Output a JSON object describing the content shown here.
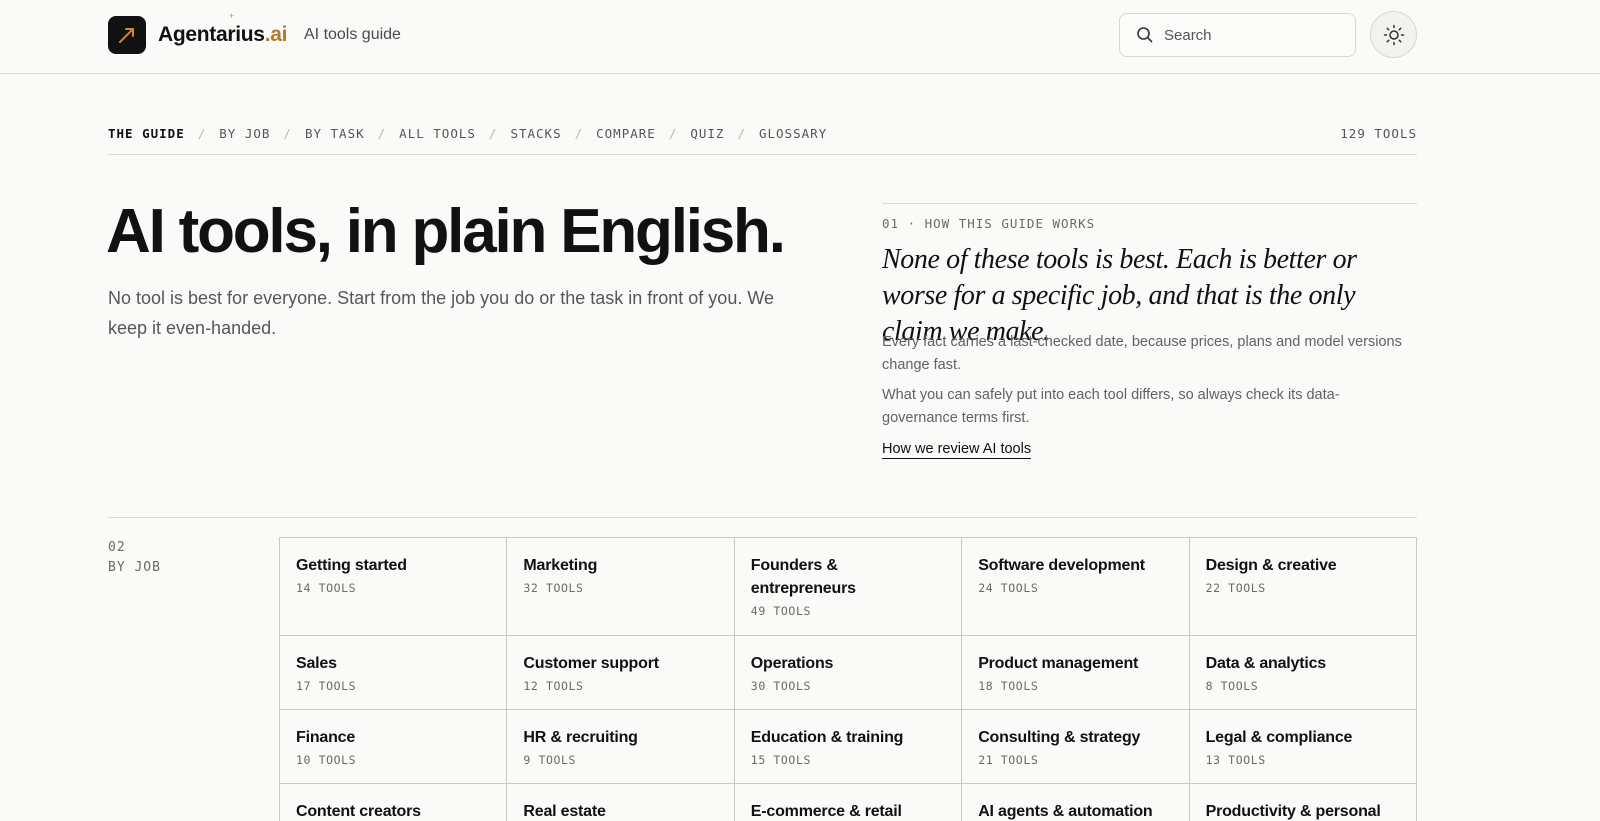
{
  "header": {
    "brand_name": "Agentarius",
    "brand_tld": ".ai",
    "brand_spark": "+",
    "subtitle": "AI tools guide",
    "search_placeholder": "Search",
    "logo_icon": "arrow-up-right-icon",
    "theme_icon": "sun-icon",
    "accent_color": "#b8782a"
  },
  "nav": {
    "items": [
      {
        "label": "THE GUIDE",
        "active": true
      },
      {
        "label": "BY JOB"
      },
      {
        "label": "BY TASK"
      },
      {
        "label": "ALL TOOLS"
      },
      {
        "label": "STACKS"
      },
      {
        "label": "COMPARE"
      },
      {
        "label": "QUIZ"
      },
      {
        "label": "GLOSSARY"
      }
    ],
    "separator": "/",
    "tool_count": "129 TOOLS"
  },
  "hero": {
    "title": "AI tools, in plain English.",
    "subtitle": "No tool is best for everyone. Start from the job you do or the task in front of you. We keep it even-handed."
  },
  "how": {
    "kicker": "01 · HOW THIS GUIDE WORKS",
    "quote": "None of these tools is best. Each is better or worse for a specific job, and that is the only claim we make.",
    "p1": "Every fact carries a last-checked date, because prices, plans and model versions change fast.",
    "p2": "What you can safely put into each tool differs, so always check its data-governance terms first.",
    "link": "How we review AI tools"
  },
  "by_job": {
    "number": "02",
    "label": "BY JOB",
    "jobs": [
      {
        "title": "Getting started",
        "count": "14 TOOLS"
      },
      {
        "title": "Marketing",
        "count": "32 TOOLS"
      },
      {
        "title": "Founders & entrepreneurs",
        "count": "49 TOOLS"
      },
      {
        "title": "Software development",
        "count": "24 TOOLS"
      },
      {
        "title": "Design & creative",
        "count": "22 TOOLS"
      },
      {
        "title": "Sales",
        "count": "17 TOOLS"
      },
      {
        "title": "Customer support",
        "count": "12 TOOLS"
      },
      {
        "title": "Operations",
        "count": "30 TOOLS"
      },
      {
        "title": "Product management",
        "count": "18 TOOLS"
      },
      {
        "title": "Data & analytics",
        "count": "8 TOOLS"
      },
      {
        "title": "Finance",
        "count": "10 TOOLS"
      },
      {
        "title": "HR & recruiting",
        "count": "9 TOOLS"
      },
      {
        "title": "Education & training",
        "count": "15 TOOLS"
      },
      {
        "title": "Consulting & strategy",
        "count": "21 TOOLS"
      },
      {
        "title": "Legal & compliance",
        "count": "13 TOOLS"
      },
      {
        "title": "Content creators",
        "count": ""
      },
      {
        "title": "Real estate",
        "count": ""
      },
      {
        "title": "E-commerce & retail",
        "count": ""
      },
      {
        "title": "AI agents & automation",
        "count": ""
      },
      {
        "title": "Productivity & personal",
        "count": ""
      }
    ]
  }
}
